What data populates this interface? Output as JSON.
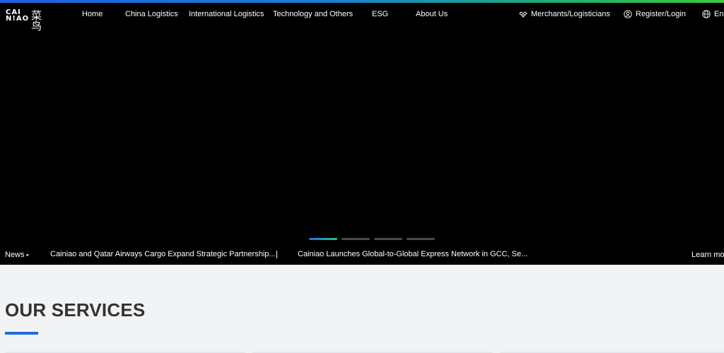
{
  "logo": {
    "latin": "CAI\nN!AO",
    "chinese": "菜鸟"
  },
  "nav": {
    "items": [
      {
        "label": "Home"
      },
      {
        "label": "China Logistics"
      },
      {
        "label": "International Logistics"
      },
      {
        "label": "Technology and Others"
      },
      {
        "label": "ESG"
      },
      {
        "label": "About Us"
      }
    ],
    "merchants_label": "Merchants/Logisticians",
    "register_label": "Register/Login",
    "language_label": "En"
  },
  "carousel": {
    "slide_count": 4,
    "active_index": 0
  },
  "news": {
    "label": "News",
    "items": [
      "Cainiao and Qatar Airways Cargo Expand Strategic Partnership...",
      "Cainiao Launches Global-to-Global Express Network in GCC, Se..."
    ],
    "learn_more": "Learn more"
  },
  "services": {
    "title": "OUR SERVICES"
  },
  "colors": {
    "accent_blue": "#1f6bdf",
    "accent_green": "#28c76f",
    "hero_bg": "#000000",
    "page_bg": "#f2f3f5"
  }
}
